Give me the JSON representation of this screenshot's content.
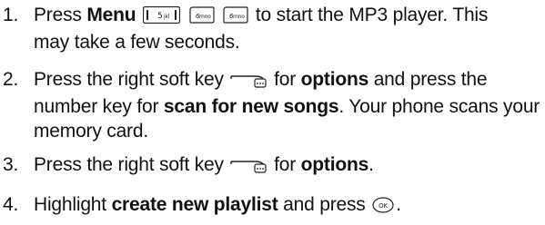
{
  "steps": [
    {
      "number": "1.",
      "line1_a": "Press",
      "line1_bold": "Menu",
      "line1_b": "to start the MP3 player. This",
      "line2": "may take a few seconds.",
      "keys": [
        "5-key",
        "6-key",
        "6-key"
      ],
      "key_labels": [
        "5",
        "6",
        "6"
      ]
    },
    {
      "number": "2.",
      "line1_a": "Press the right soft key",
      "line1_b": "for",
      "line1_bold": "options",
      "line1_c": "and press the",
      "line2_a": "number key for",
      "line2_bold": "scan for new songs",
      "line2_b": ". Your phone scans your",
      "line3": "memory card."
    },
    {
      "number": "3.",
      "line1_a": "Press the right soft key",
      "line1_b": "for",
      "line1_bold": "options",
      "line1_c": "."
    },
    {
      "number": "4.",
      "line1_a": "Highlight",
      "line1_bold": "create new playlist",
      "line1_b": "and press",
      "line1_c": ".",
      "ok_label": "OK"
    }
  ]
}
